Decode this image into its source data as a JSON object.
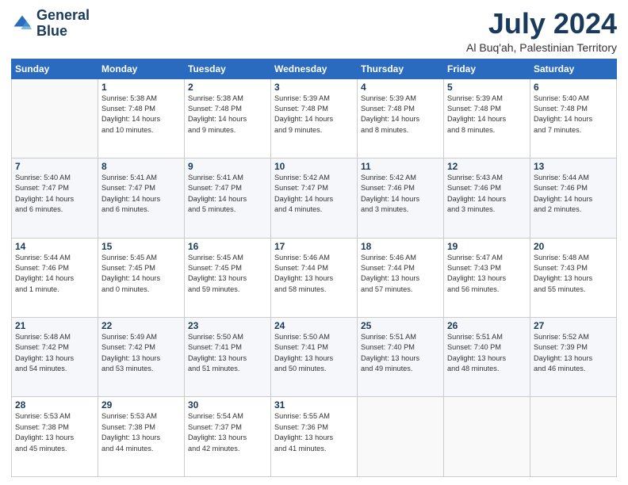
{
  "logo": {
    "line1": "General",
    "line2": "Blue"
  },
  "header": {
    "month": "July 2024",
    "location": "Al Buq'ah, Palestinian Territory"
  },
  "weekdays": [
    "Sunday",
    "Monday",
    "Tuesday",
    "Wednesday",
    "Thursday",
    "Friday",
    "Saturday"
  ],
  "weeks": [
    [
      {
        "day": "",
        "info": ""
      },
      {
        "day": "1",
        "info": "Sunrise: 5:38 AM\nSunset: 7:48 PM\nDaylight: 14 hours\nand 10 minutes."
      },
      {
        "day": "2",
        "info": "Sunrise: 5:38 AM\nSunset: 7:48 PM\nDaylight: 14 hours\nand 9 minutes."
      },
      {
        "day": "3",
        "info": "Sunrise: 5:39 AM\nSunset: 7:48 PM\nDaylight: 14 hours\nand 9 minutes."
      },
      {
        "day": "4",
        "info": "Sunrise: 5:39 AM\nSunset: 7:48 PM\nDaylight: 14 hours\nand 8 minutes."
      },
      {
        "day": "5",
        "info": "Sunrise: 5:39 AM\nSunset: 7:48 PM\nDaylight: 14 hours\nand 8 minutes."
      },
      {
        "day": "6",
        "info": "Sunrise: 5:40 AM\nSunset: 7:48 PM\nDaylight: 14 hours\nand 7 minutes."
      }
    ],
    [
      {
        "day": "7",
        "info": "Sunrise: 5:40 AM\nSunset: 7:47 PM\nDaylight: 14 hours\nand 6 minutes."
      },
      {
        "day": "8",
        "info": "Sunrise: 5:41 AM\nSunset: 7:47 PM\nDaylight: 14 hours\nand 6 minutes."
      },
      {
        "day": "9",
        "info": "Sunrise: 5:41 AM\nSunset: 7:47 PM\nDaylight: 14 hours\nand 5 minutes."
      },
      {
        "day": "10",
        "info": "Sunrise: 5:42 AM\nSunset: 7:47 PM\nDaylight: 14 hours\nand 4 minutes."
      },
      {
        "day": "11",
        "info": "Sunrise: 5:42 AM\nSunset: 7:46 PM\nDaylight: 14 hours\nand 3 minutes."
      },
      {
        "day": "12",
        "info": "Sunrise: 5:43 AM\nSunset: 7:46 PM\nDaylight: 14 hours\nand 3 minutes."
      },
      {
        "day": "13",
        "info": "Sunrise: 5:44 AM\nSunset: 7:46 PM\nDaylight: 14 hours\nand 2 minutes."
      }
    ],
    [
      {
        "day": "14",
        "info": "Sunrise: 5:44 AM\nSunset: 7:46 PM\nDaylight: 14 hours\nand 1 minute."
      },
      {
        "day": "15",
        "info": "Sunrise: 5:45 AM\nSunset: 7:45 PM\nDaylight: 14 hours\nand 0 minutes."
      },
      {
        "day": "16",
        "info": "Sunrise: 5:45 AM\nSunset: 7:45 PM\nDaylight: 13 hours\nand 59 minutes."
      },
      {
        "day": "17",
        "info": "Sunrise: 5:46 AM\nSunset: 7:44 PM\nDaylight: 13 hours\nand 58 minutes."
      },
      {
        "day": "18",
        "info": "Sunrise: 5:46 AM\nSunset: 7:44 PM\nDaylight: 13 hours\nand 57 minutes."
      },
      {
        "day": "19",
        "info": "Sunrise: 5:47 AM\nSunset: 7:43 PM\nDaylight: 13 hours\nand 56 minutes."
      },
      {
        "day": "20",
        "info": "Sunrise: 5:48 AM\nSunset: 7:43 PM\nDaylight: 13 hours\nand 55 minutes."
      }
    ],
    [
      {
        "day": "21",
        "info": "Sunrise: 5:48 AM\nSunset: 7:42 PM\nDaylight: 13 hours\nand 54 minutes."
      },
      {
        "day": "22",
        "info": "Sunrise: 5:49 AM\nSunset: 7:42 PM\nDaylight: 13 hours\nand 53 minutes."
      },
      {
        "day": "23",
        "info": "Sunrise: 5:50 AM\nSunset: 7:41 PM\nDaylight: 13 hours\nand 51 minutes."
      },
      {
        "day": "24",
        "info": "Sunrise: 5:50 AM\nSunset: 7:41 PM\nDaylight: 13 hours\nand 50 minutes."
      },
      {
        "day": "25",
        "info": "Sunrise: 5:51 AM\nSunset: 7:40 PM\nDaylight: 13 hours\nand 49 minutes."
      },
      {
        "day": "26",
        "info": "Sunrise: 5:51 AM\nSunset: 7:40 PM\nDaylight: 13 hours\nand 48 minutes."
      },
      {
        "day": "27",
        "info": "Sunrise: 5:52 AM\nSunset: 7:39 PM\nDaylight: 13 hours\nand 46 minutes."
      }
    ],
    [
      {
        "day": "28",
        "info": "Sunrise: 5:53 AM\nSunset: 7:38 PM\nDaylight: 13 hours\nand 45 minutes."
      },
      {
        "day": "29",
        "info": "Sunrise: 5:53 AM\nSunset: 7:38 PM\nDaylight: 13 hours\nand 44 minutes."
      },
      {
        "day": "30",
        "info": "Sunrise: 5:54 AM\nSunset: 7:37 PM\nDaylight: 13 hours\nand 42 minutes."
      },
      {
        "day": "31",
        "info": "Sunrise: 5:55 AM\nSunset: 7:36 PM\nDaylight: 13 hours\nand 41 minutes."
      },
      {
        "day": "",
        "info": ""
      },
      {
        "day": "",
        "info": ""
      },
      {
        "day": "",
        "info": ""
      }
    ]
  ]
}
